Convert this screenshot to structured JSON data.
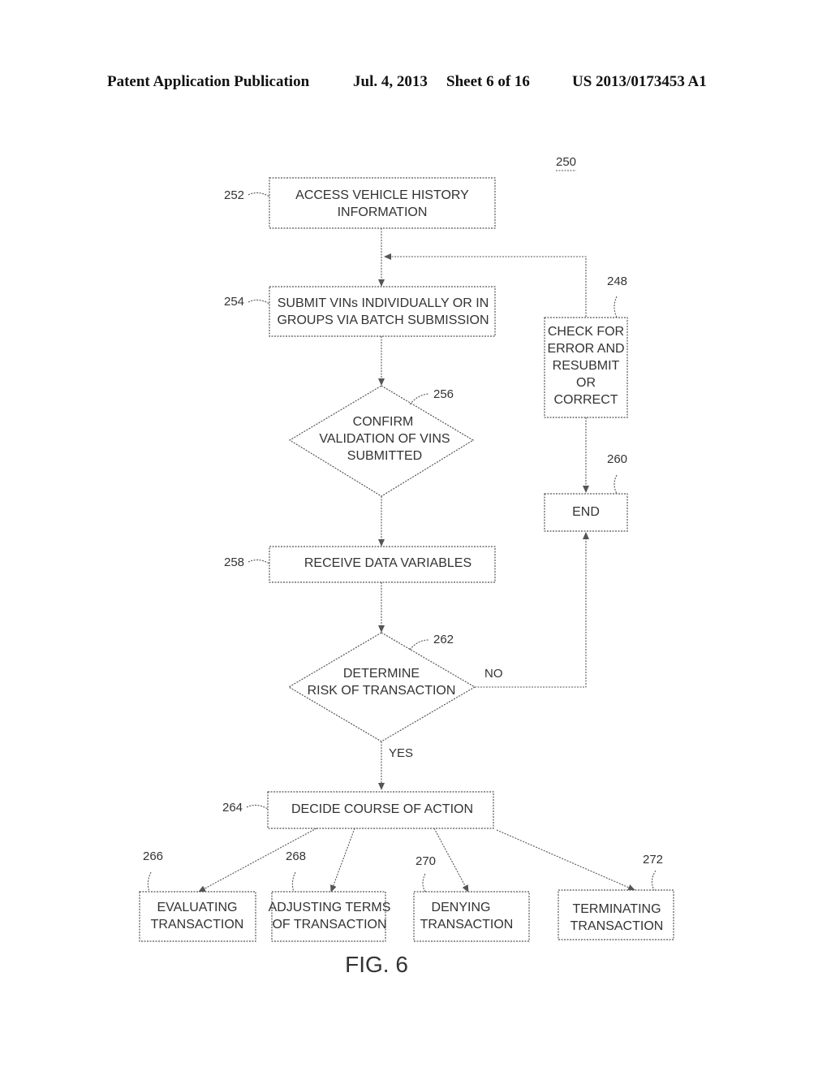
{
  "header": {
    "publication": "Patent Application Publication",
    "date": "Jul. 4, 2013",
    "sheet": "Sheet 6 of 16",
    "number": "US 2013/0173453 A1"
  },
  "figure": {
    "ref": "250",
    "caption": "FIG. 6",
    "nodes": {
      "n252": {
        "ref": "252",
        "lines": [
          "ACCESS VEHICLE HISTORY",
          "INFORMATION"
        ]
      },
      "n254": {
        "ref": "254",
        "lines": [
          "SUBMIT VINs INDIVIDUALLY OR IN",
          "GROUPS VIA BATCH SUBMISSION"
        ]
      },
      "n256": {
        "ref": "256",
        "lines": [
          "CONFIRM",
          "VALIDATION OF VINS",
          "SUBMITTED"
        ]
      },
      "n258": {
        "ref": "258",
        "lines": [
          "RECEIVE DATA VARIABLES"
        ]
      },
      "n262": {
        "ref": "262",
        "lines": [
          "DETERMINE",
          "RISK OF TRANSACTION"
        ]
      },
      "n264": {
        "ref": "264",
        "lines": [
          "DECIDE COURSE OF ACTION"
        ]
      },
      "n248": {
        "ref": "248",
        "lines": [
          "CHECK FOR",
          "ERROR AND",
          "RESUBMIT",
          "OR",
          "CORRECT"
        ]
      },
      "n260": {
        "ref": "260",
        "lines": [
          "END"
        ]
      },
      "n266": {
        "ref": "266",
        "lines": [
          "EVALUATING",
          "TRANSACTION"
        ]
      },
      "n268": {
        "ref": "268",
        "lines": [
          "ADJUSTING TERMS",
          "OF TRANSACTION"
        ]
      },
      "n270": {
        "ref": "270",
        "lines": [
          "DENYING",
          "TRANSACTION"
        ]
      },
      "n272": {
        "ref": "272",
        "lines": [
          "TERMINATING",
          "TRANSACTION"
        ]
      }
    },
    "edge_labels": {
      "no": "NO",
      "yes": "YES"
    }
  }
}
